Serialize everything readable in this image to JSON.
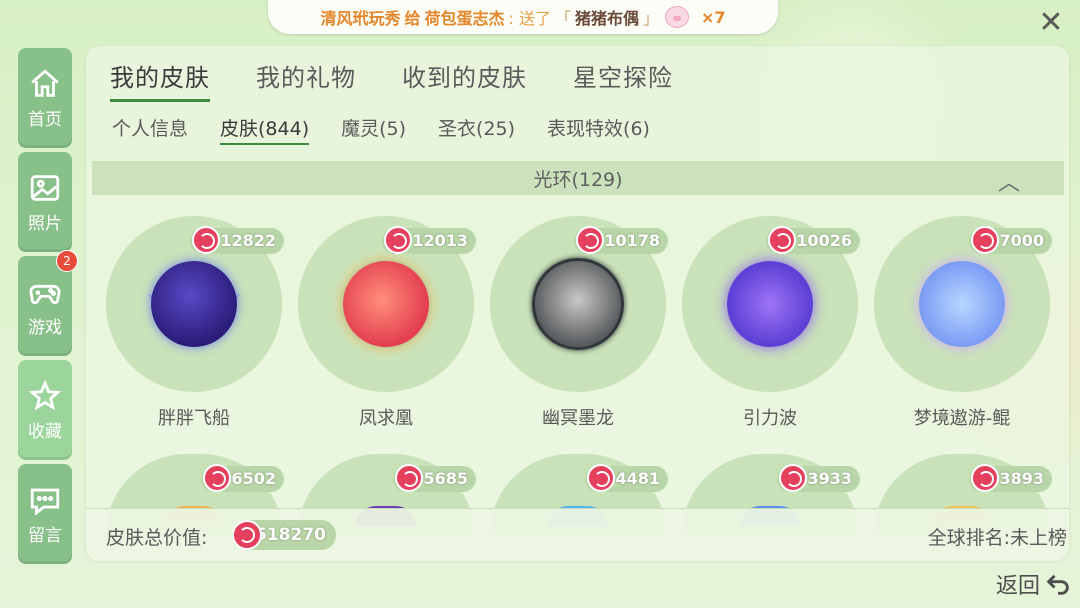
{
  "banner": {
    "sender": "清风玳玩秀",
    "verb": "给",
    "receiver": "荷包蛋志杰",
    "sent_text": ": 送了",
    "gift_open": "「",
    "gift": "猪猪布偶",
    "gift_close": "」",
    "times": "×7"
  },
  "close_label": "✕",
  "nav": [
    {
      "label": "首页",
      "icon": "home-icon"
    },
    {
      "label": "照片",
      "icon": "photo-icon"
    },
    {
      "label": "游戏",
      "icon": "gamepad-icon",
      "badge": "2"
    },
    {
      "label": "收藏",
      "icon": "star-icon",
      "active": true
    },
    {
      "label": "留言",
      "icon": "message-icon"
    }
  ],
  "tabs": [
    "我的皮肤",
    "我的礼物",
    "收到的皮肤",
    "星空探险"
  ],
  "subtabs": [
    "个人信息",
    "皮肤(844)",
    "魔灵(5)",
    "圣衣(25)",
    "表现特效(6)"
  ],
  "section": {
    "title": "光环(129)",
    "collapse_icon": "chevron-up-icon"
  },
  "items_row1": [
    {
      "name": "胖胖飞船",
      "price": "12822"
    },
    {
      "name": "凤求凰",
      "price": "12013"
    },
    {
      "name": "幽冥墨龙",
      "price": "10178"
    },
    {
      "name": "引力波",
      "price": "10026"
    },
    {
      "name": "梦境遨游-鲲",
      "price": "7000"
    }
  ],
  "items_row2": [
    {
      "price": "6502"
    },
    {
      "price": "5685"
    },
    {
      "price": "4481"
    },
    {
      "price": "3933"
    },
    {
      "price": "3893"
    }
  ],
  "footer": {
    "total_label": "皮肤总价值:",
    "total_value": "518270",
    "rank_label": "全球排名:未上榜",
    "back_label": "返回"
  },
  "colors": {
    "accent": "#3f8a3f",
    "nav": "#88c08a",
    "currency": "#e5415f"
  }
}
